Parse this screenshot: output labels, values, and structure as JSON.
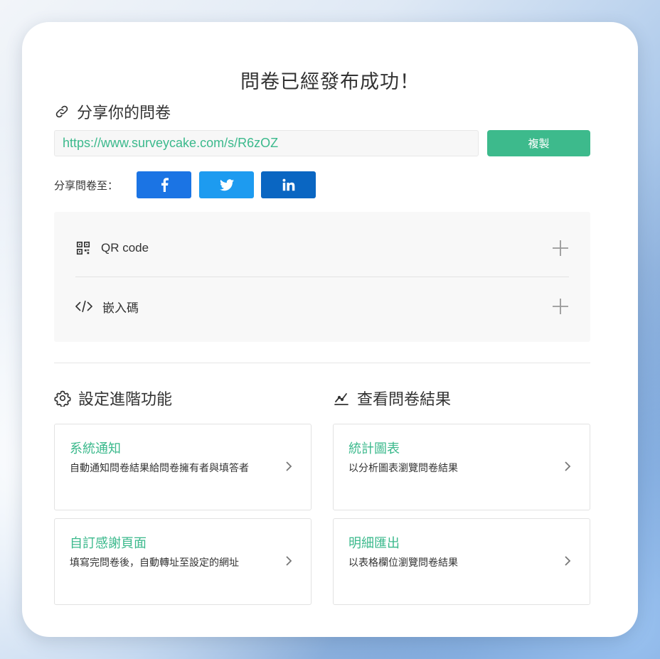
{
  "dialog": {
    "title": "問卷已經發布成功！"
  },
  "share": {
    "heading": "分享你的問卷",
    "url": "https://www.surveycake.com/s/R6zOZ",
    "copy_label": "複製",
    "share_to_label": "分享問卷至：",
    "networks": [
      "facebook-icon",
      "twitter-icon",
      "linkedin-icon"
    ]
  },
  "accordion": {
    "items": [
      {
        "label": "QR code",
        "icon": "qr-code-icon"
      },
      {
        "label": "嵌入碼",
        "icon": "code-icon"
      }
    ]
  },
  "settings": {
    "heading": "設定進階功能",
    "tiles": [
      {
        "title": "系統通知",
        "desc": "自動通知問卷結果給問卷擁有者與填答者"
      },
      {
        "title": "自訂感謝頁面",
        "desc": "填寫完問卷後，自動轉址至設定的網址"
      }
    ]
  },
  "results": {
    "heading": "查看問卷結果",
    "tiles": [
      {
        "title": "統計圖表",
        "desc": "以分析圖表瀏覽問卷結果"
      },
      {
        "title": "明細匯出",
        "desc": "以表格欄位瀏覽問卷結果"
      }
    ]
  },
  "colors": {
    "accent": "#3dba8c",
    "facebook": "#1b74e4",
    "twitter": "#1d9bf0",
    "linkedin": "#0a66c2"
  }
}
